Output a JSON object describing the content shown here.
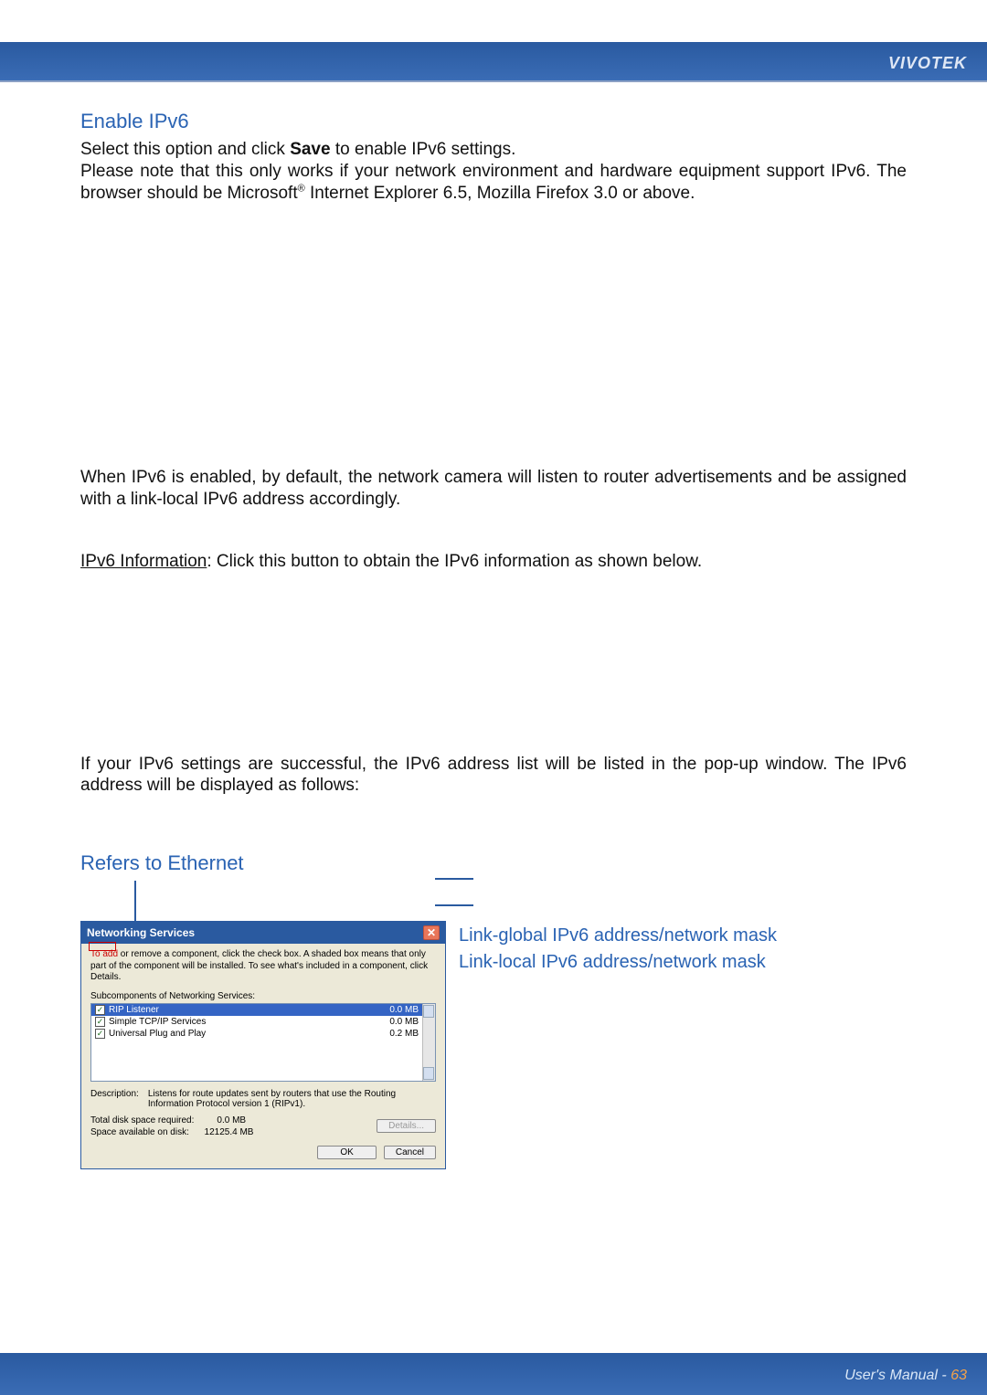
{
  "brand": "VIVOTEK",
  "footer": {
    "label": "User's Manual - ",
    "page": "63"
  },
  "section": {
    "title": "Enable IPv6",
    "p1a": "Select this option and click ",
    "p1_bold": "Save",
    "p1b": " to enable IPv6 settings.",
    "p2a": "Please note that this only works if your network environment and hardware equipment support IPv6. The browser should be Microsoft",
    "p2_sup": "®",
    "p2b": " Internet Explorer 6.5, Mozilla Firefox 3.0 or above.",
    "p3": "When IPv6 is enabled, by default, the network camera will listen to router advertisements and be assigned with a link-local IPv6 address accordingly.",
    "p4_u": "IPv6 Information",
    "p4b": ": Click this button to obtain the IPv6 information as shown below.",
    "p5": "If your IPv6 settings are successful, the IPv6 address list will be listed in the pop-up window. The IPv6 address will be displayed as follows:",
    "refers": "Refers to Ethernet"
  },
  "dialog": {
    "title": "Networking Services",
    "hint_red": "To add",
    "hint_rest": " or remove a component, click the check box. A shaded box means that only part of the component will be installed. To see what's included in a component, click Details.",
    "sub_label": "Subcomponents of Networking Services:",
    "items": [
      {
        "name": "RIP Listener",
        "size": "0.0 MB",
        "selected": true
      },
      {
        "name": "Simple TCP/IP Services",
        "size": "0.0 MB",
        "selected": false
      },
      {
        "name": "Universal Plug and Play",
        "size": "0.2 MB",
        "selected": false
      }
    ],
    "desc_label": "Description:",
    "desc_text": "Listens for route updates sent by routers that use the Routing Information Protocol version 1 (RIPv1).",
    "disk_req_label": "Total disk space required:",
    "disk_req_val": "0.0 MB",
    "disk_avail_label": "Space available on disk:",
    "disk_avail_val": "12125.4 MB",
    "details_btn": "Details...",
    "ok": "OK",
    "cancel": "Cancel"
  },
  "annotations": {
    "a1": "Link-global IPv6 address/network mask",
    "a2": "Link-local IPv6 address/network mask"
  }
}
